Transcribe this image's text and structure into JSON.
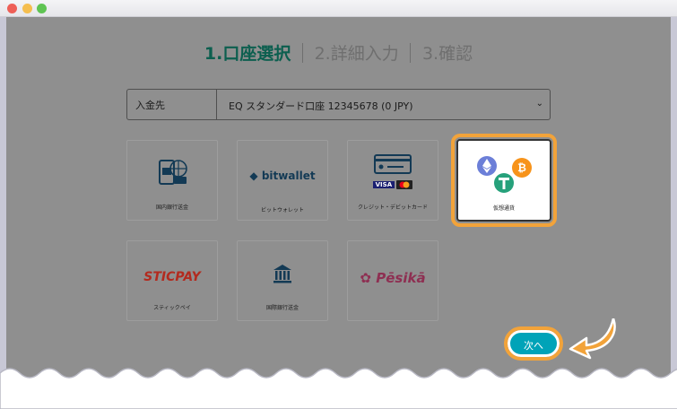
{
  "steps": [
    {
      "label": "1.口座選択",
      "active": true
    },
    {
      "label": "2.詳細入力",
      "active": false
    },
    {
      "label": "3.確認",
      "active": false
    }
  ],
  "deposit": {
    "label": "入金先",
    "selected": "EQ スタンダード口座 12345678 (0 JPY)"
  },
  "methods": {
    "domestic_bank": "国内銀行送金",
    "bitwallet_logo": "bitwallet",
    "bitwallet": "ビットウォレット",
    "card": "クレジット・デビットカード",
    "visa": "VISA",
    "crypto": "仮想通貨",
    "sticpay_logo": "STICPAY",
    "sticpay": "スティックペイ",
    "intl_bank": "国際銀行送金",
    "pesika_logo": "Pēsikā"
  },
  "next_button": "次へ",
  "colors": {
    "accent_orange": "#f2a33a",
    "next_button": "#00a3b8",
    "active_step": "#0c5f4f"
  }
}
